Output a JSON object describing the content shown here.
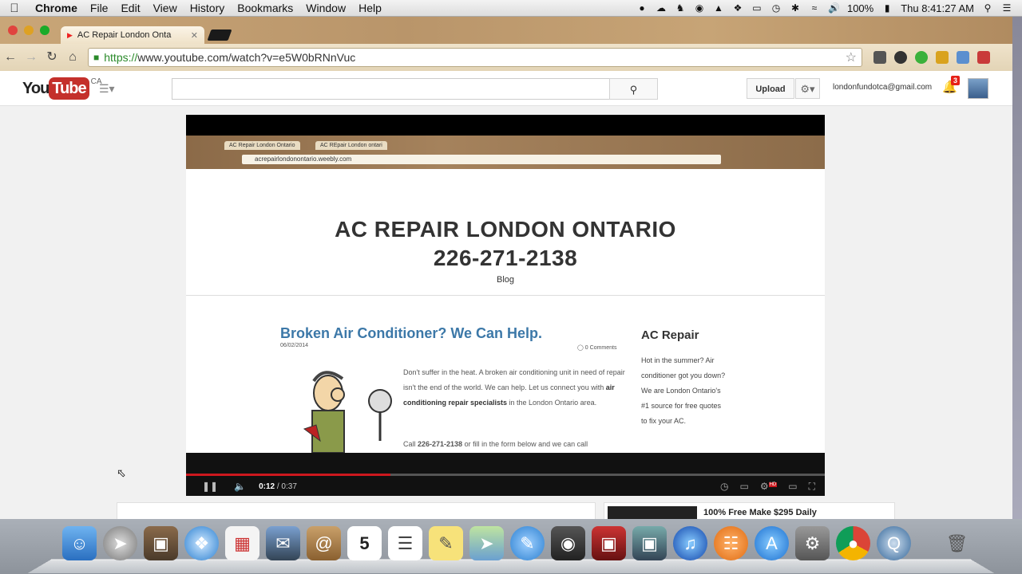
{
  "menubar": {
    "apple": "",
    "app": "Chrome",
    "items": [
      "File",
      "Edit",
      "View",
      "History",
      "Bookmarks",
      "Window",
      "Help"
    ],
    "battery": "100%",
    "clock": "Thu 8:41:27 AM"
  },
  "browser": {
    "tab_title": "AC Repair London Onta",
    "url_scheme": "https://",
    "url_rest": "www.youtube.com/watch?v=e5W0bRNnVuc"
  },
  "youtube": {
    "logo_you": "You",
    "logo_tube": "Tube",
    "country": "CA",
    "upload_label": "Upload",
    "email": "londonfundotca@gmail.com",
    "notifications": "3"
  },
  "video": {
    "tab1": "AC Repair London Ontario",
    "tab2": "AC REpair London ontari",
    "address": "acrepairlondonontario.weebly.com",
    "site_title_line1": "AC REPAIR LONDON ONTARIO",
    "site_title_line2": "226-271-2138",
    "nav_blog": "Blog",
    "post_title": "Broken Air Conditioner?  We Can Help.",
    "post_date": "06/02/2014",
    "post_comments": "0 Comments",
    "post_body_1": "Don't suffer in the heat.  A broken air conditioning unit in need of repair isn't the end of the world.  We can help.  Let us connect you with ",
    "post_body_bold": "air conditioning repair specialists",
    "post_body_2": " in the London Ontario area.",
    "post_body_call_a": "Call ",
    "post_body_call_num": "226-271-2138",
    "post_body_call_b": " or fill in the form below and we can call",
    "side_title": "AC Repair",
    "side_body": "Hot in the summer?  Air conditioner got you down?  We are London Ontario's #1 source for free quotes to fix your AC.",
    "current_time": "0:12",
    "duration": "/ 0:37",
    "progress_fraction": 0.32,
    "hd_badge": "HD"
  },
  "below_ad": "100% Free Make $295 Daily",
  "colors": {
    "youtube_red": "#c4302b",
    "progress_red": "#cc181e",
    "link_blue": "#3c78a8"
  }
}
